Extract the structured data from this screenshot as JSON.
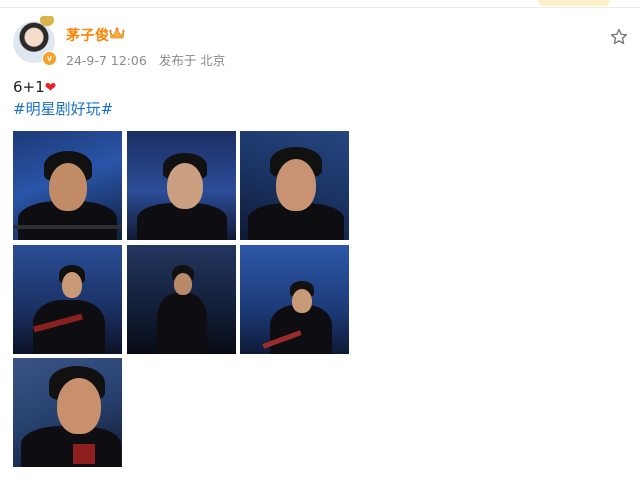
{
  "user": {
    "name": "茅子俊",
    "avatar_badge": "v"
  },
  "post": {
    "date": "24-9-7 12:06",
    "location": "发布于 北京",
    "text": "6+1",
    "heart": "❤",
    "hashtag": "#明星剧好玩#"
  },
  "icons": {
    "crown": "crown-icon",
    "star": "star-icon",
    "vip": "verified-badge-icon"
  },
  "colors": {
    "username": "#ff8200",
    "hashtag": "#1a70c9",
    "heart": "#e8242a",
    "meta": "#8a8a8a"
  },
  "images": [
    {
      "alt": "photo-1"
    },
    {
      "alt": "photo-2"
    },
    {
      "alt": "photo-3"
    },
    {
      "alt": "photo-4"
    },
    {
      "alt": "photo-5"
    },
    {
      "alt": "photo-6"
    },
    {
      "alt": "photo-7"
    }
  ]
}
